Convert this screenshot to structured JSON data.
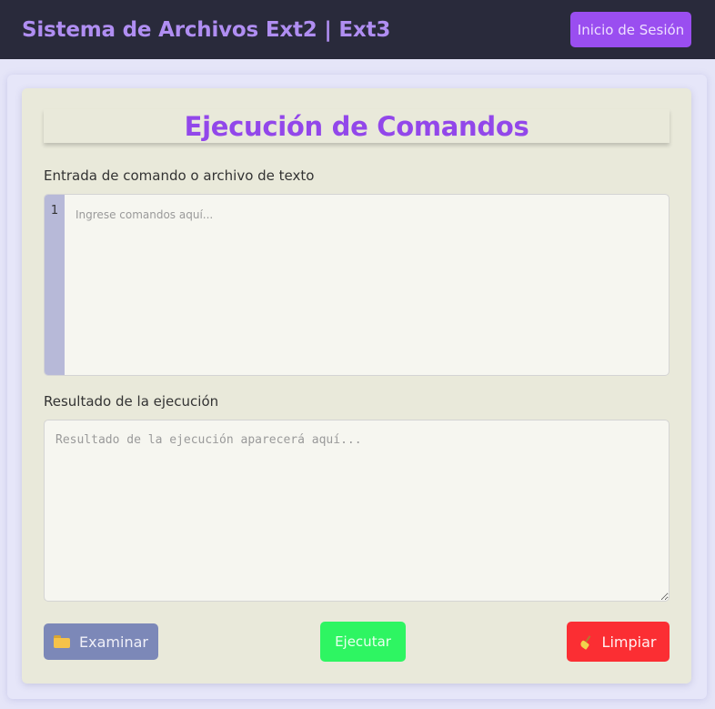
{
  "header": {
    "title": "Sistema de Archivos Ext2 | Ext3",
    "login_label": "Inicio de Sesión"
  },
  "main": {
    "heading": "Ejecución de Comandos",
    "command_label": "Entrada de comando o archivo de texto",
    "command_line_number": "1",
    "command_placeholder": "Ingrese comandos aquí...",
    "command_value": "",
    "result_label": "Resultado de la ejecución",
    "result_placeholder": "Resultado de la ejecución aparecerá aquí...",
    "result_value": ""
  },
  "actions": {
    "browse_label": "Examinar",
    "browse_icon": "folder-icon",
    "run_label": "Ejecutar",
    "clear_label": "Limpiar",
    "clear_icon": "broom-icon"
  },
  "colors": {
    "header_bg": "#292a3b",
    "title": "#b08ef2",
    "login_button": "#9a4ef0",
    "heading": "#9247ea",
    "browse_button": "#7c88b8",
    "run_button": "#2ef562",
    "clear_button": "#fb2e33",
    "gutter": "#b7b9d8"
  }
}
